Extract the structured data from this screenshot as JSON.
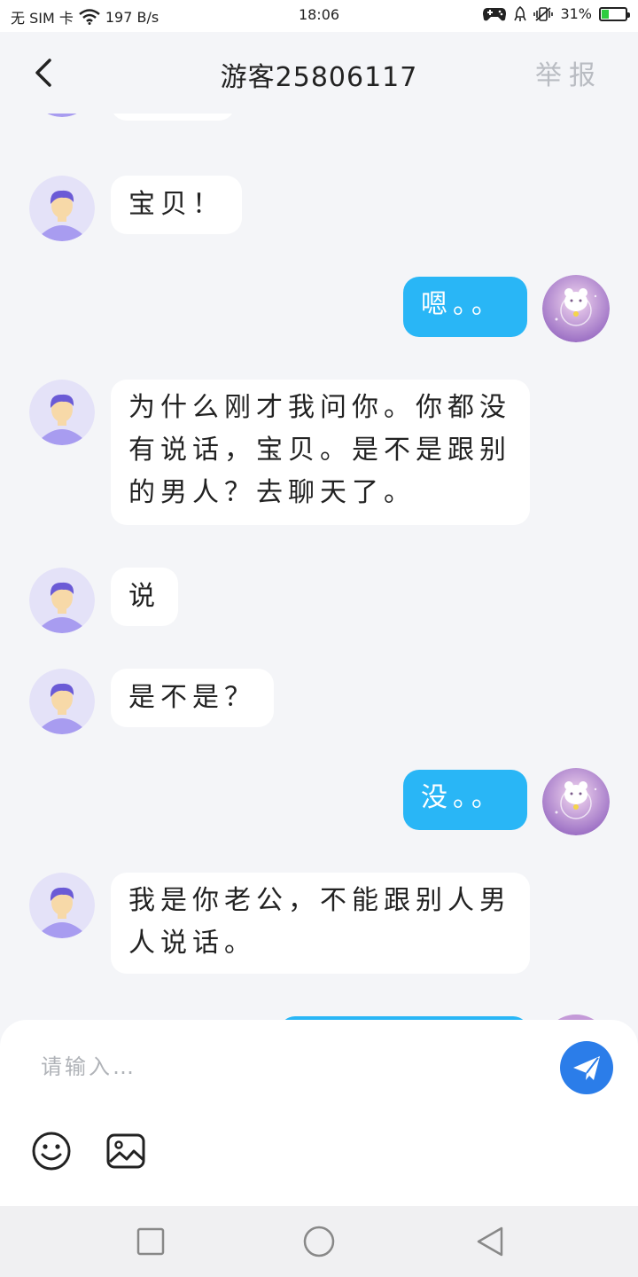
{
  "status_bar": {
    "carrier": "无 SIM 卡",
    "network_speed": "197 B/s",
    "time": "18:06",
    "battery_percent": "31%",
    "battery_level": 0.31
  },
  "header": {
    "title": "游客25806117",
    "report_label": "举报"
  },
  "messages": [
    {
      "side": "in",
      "text": ""
    },
    {
      "side": "in",
      "text": "宝贝！"
    },
    {
      "side": "out",
      "text": "嗯。。"
    },
    {
      "side": "in",
      "lines": [
        "为什么刚才我问你。你都没",
        "有说话，宝贝。是不是跟别",
        "的男人？去聊天了。"
      ]
    },
    {
      "side": "in",
      "text": "说"
    },
    {
      "side": "in",
      "text": "是不是？"
    },
    {
      "side": "out",
      "text": "没。。"
    },
    {
      "side": "in",
      "lines": [
        "我是你老公，不能跟别人男",
        "人说话。"
      ]
    }
  ],
  "input": {
    "placeholder": "请输入…"
  },
  "colors": {
    "outgoing_bubble": "#29b6f6",
    "incoming_bubble": "#ffffff",
    "send_button": "#2b7de9",
    "background": "#f4f5f8"
  },
  "icons": {
    "back": "chevron-left-icon",
    "send": "paper-plane-icon",
    "emoji": "smiley-icon",
    "image": "image-icon"
  }
}
